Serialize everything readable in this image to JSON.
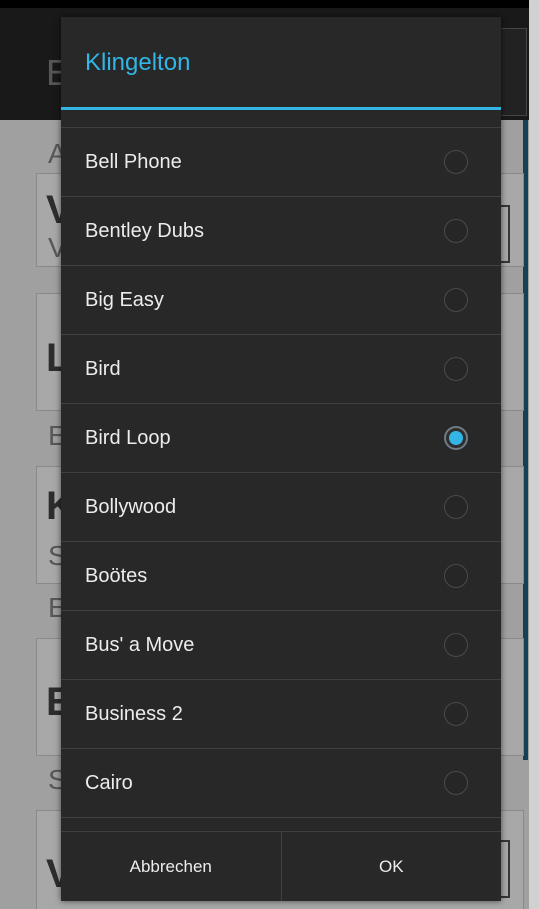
{
  "dialog": {
    "title": "Klingelton",
    "accent_color": "#33b5e5",
    "items": [
      {
        "label": "Bell Phone",
        "checked": false
      },
      {
        "label": "Bentley Dubs",
        "checked": false
      },
      {
        "label": "Big Easy",
        "checked": false
      },
      {
        "label": "Bird",
        "checked": false
      },
      {
        "label": "Bird Loop",
        "checked": true
      },
      {
        "label": "Bollywood",
        "checked": false
      },
      {
        "label": "Boötes",
        "checked": false
      },
      {
        "label": "Bus' a Move",
        "checked": false
      },
      {
        "label": "Business 2",
        "checked": false
      },
      {
        "label": "Cairo",
        "checked": false
      }
    ],
    "cancel_label": "Abbrechen",
    "ok_label": "OK"
  },
  "background": {
    "action_letter": "E",
    "letters": [
      "A",
      "V",
      "V",
      "L",
      "E",
      "K",
      "S",
      "E",
      "E",
      "S",
      "V"
    ]
  }
}
